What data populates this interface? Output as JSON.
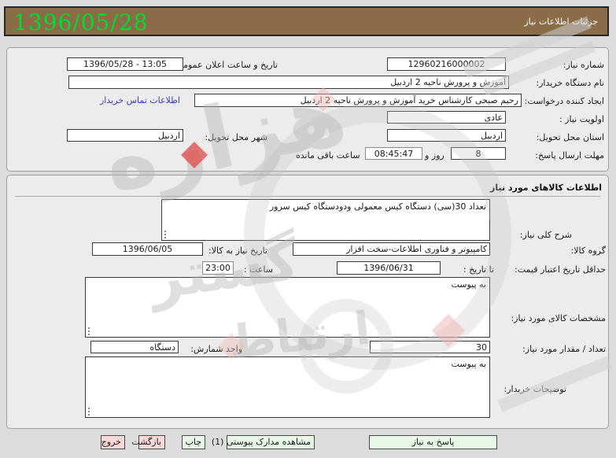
{
  "header": {
    "date": "1396/05/28",
    "title": "جزئیات اطلاعات نیاز"
  },
  "p1": {
    "need_number_label": "شماره نیاز:",
    "need_number": "12960216000002",
    "announce_label": "تاریخ و ساعت اعلان عمومی:",
    "announce": "1396/05/28 - 13:05",
    "buyer_org_label": "نام دستگاه خریدار:",
    "buyer_org": "آموزش و پرورش ناحیه 2 اردبیل",
    "creator_label": "ایجاد کننده درخواست:",
    "creator": "رحیم صبحی کارشناس خرید آموزش و پرورش ناحیه 2 اردبیل",
    "contact_link": "اطلاعات تماس خریدار",
    "priority_label": "اولویت نیاز :",
    "priority": "عادی",
    "province_label": "استان محل تحویل:",
    "province": "اردبیل",
    "city_label": "شهر محل تحویل:",
    "city": "اردبیل",
    "deadline_label": "مهلت ارسال پاسخ:",
    "deadline_days": "8",
    "deadline_days_suffix": "روز و",
    "deadline_time": "08:45:47",
    "deadline_time_suffix": "ساعت باقی مانده"
  },
  "p2": {
    "title": "اطلاعات کالاهای مورد نیاز",
    "desc_label": "شرح کلی نیاز:",
    "desc": "تعداد 30(سی) دستگاه کیس معمولی ودودستگاه کیس سرور",
    "group_label": "گروه کالا:",
    "group": "کامپیوتر و فناوری اطلاعات-سخت افزار",
    "need_date_label": "تاریخ نیاز به کالا:",
    "need_date": "1396/06/05",
    "validity_label": "حداقل تاریخ اعتبار قیمت:",
    "until_label": "تا تاریخ :",
    "validity_date": "1396/06/31",
    "hour_label": "ساعت :",
    "validity_time": "23:00",
    "specs_label": "مشخصات کالای مورد نیاز:",
    "specs": "به پیوست",
    "qty_label": "تعداد / مقدار مورد نیاز:",
    "qty": "30",
    "unit_label": "واحد شمارش:",
    "unit": "دستگاه",
    "notes_label": "توضیحات خریدار:",
    "notes": "به پیوست"
  },
  "buttons": {
    "respond": "پاسخ به نیاز",
    "view_docs": "مشاهده مدارک پیوستی (1)",
    "print": "چاپ",
    "back": "بازگشت",
    "exit": "خروج"
  },
  "watermark": {
    "words": [
      "هزاره",
      "گستر",
      "ارتباط"
    ]
  },
  "colors": {
    "header_bg": "#8a6c49",
    "date_green": "#00dd2e",
    "link_blue": "#3a3ac6",
    "button_green": "#e9f7e9",
    "button_pink": "#f8d8d8",
    "diamond_red": "#e04848",
    "diamond_pink": "#f0b4b4"
  }
}
